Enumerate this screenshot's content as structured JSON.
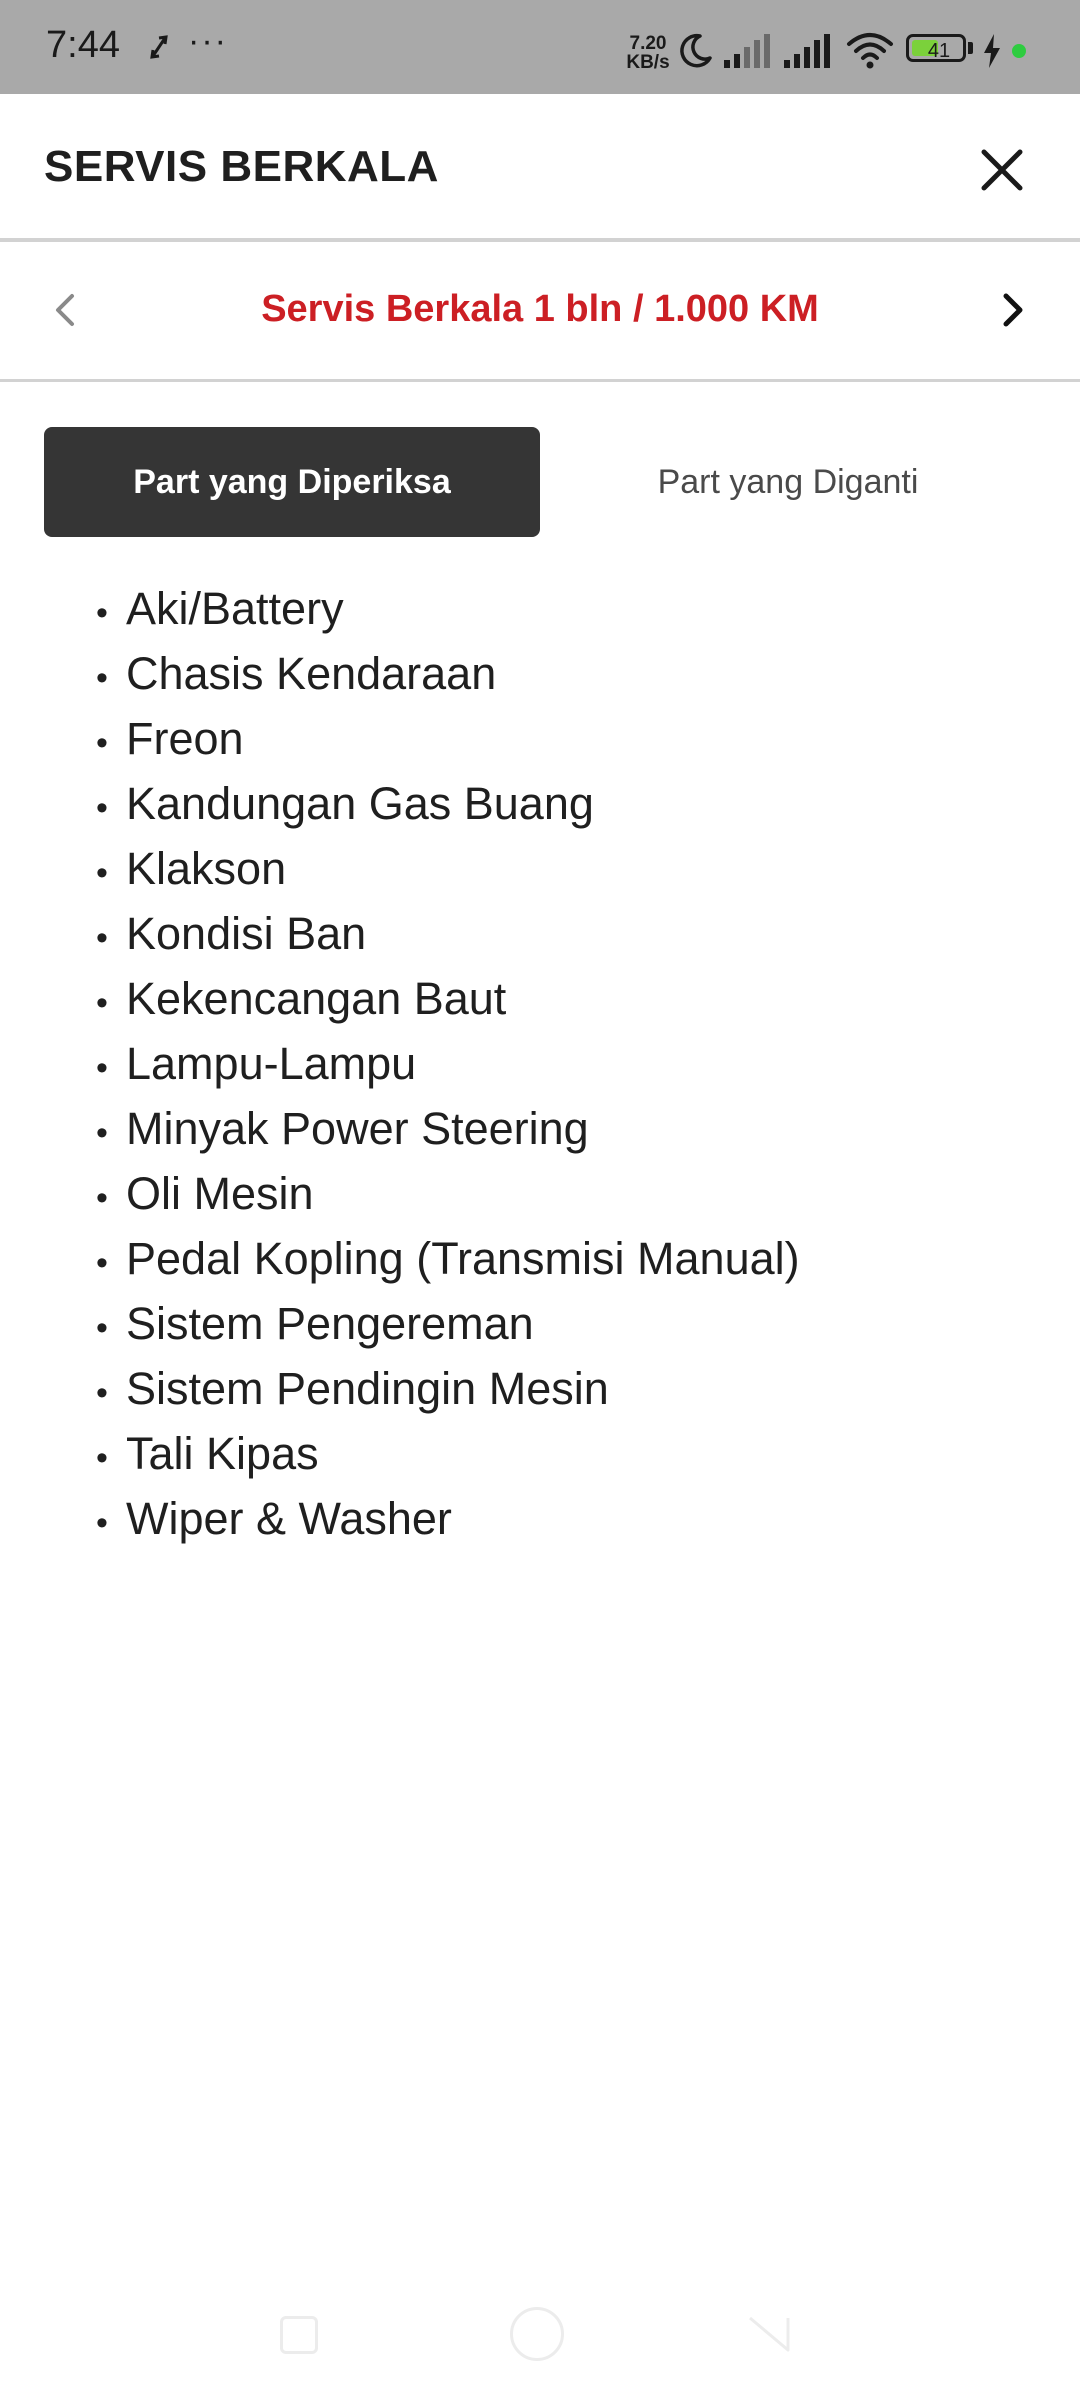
{
  "status_bar": {
    "time": "7:44",
    "dots": "···",
    "speed_value": "7.20",
    "speed_unit": "KB/s",
    "battery_level": "41",
    "icons": [
      "sync-icon",
      "moon-icon",
      "signal-icon",
      "signal-icon",
      "wifi-icon",
      "battery-icon",
      "charging-icon"
    ]
  },
  "header": {
    "title": "SERVIS BERKALA",
    "close_icon": "close-icon"
  },
  "period": {
    "title": "Servis Berkala 1 bln / 1.000 KM",
    "prev_icon": "chevron-left-icon",
    "next_icon": "chevron-right-icon"
  },
  "tabs": [
    {
      "label": "Part yang Diperiksa",
      "active": true
    },
    {
      "label": "Part yang Diganti",
      "active": false
    }
  ],
  "parts": [
    "Aki/Battery",
    "Chasis Kendaraan",
    "Freon",
    "Kandungan Gas Buang",
    "Klakson",
    "Kondisi Ban",
    "Kekencangan Baut",
    "Lampu-Lampu",
    "Minyak Power Steering",
    "Oli Mesin",
    "Pedal Kopling (Transmisi Manual)",
    "Sistem Pengereman",
    "Sistem Pendingin Mesin",
    "Tali Kipas",
    "Wiper & Washer"
  ],
  "colors": {
    "accent_red": "#cc1f24",
    "active_tab": "#353535",
    "status_bar": "#a9a9a9",
    "battery_fill": "#7bd13b",
    "charge_dot": "#2ecc40"
  }
}
